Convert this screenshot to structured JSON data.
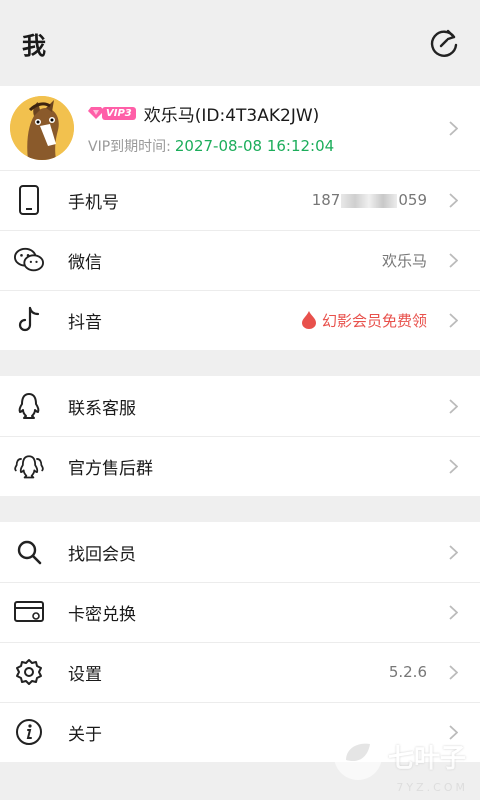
{
  "header": {
    "title": "我"
  },
  "profile": {
    "vip_badge": "VIP3",
    "name": "欢乐马(ID:4T3AK2JW)",
    "expiry_label": "VIP到期时间:",
    "expiry_date": "2027-08-08 16:12:04"
  },
  "account": {
    "phone": {
      "label": "手机号",
      "value_prefix": "187",
      "value_suffix": "059"
    },
    "wechat": {
      "label": "微信",
      "value": "欢乐马"
    },
    "douyin": {
      "label": "抖音",
      "value": "幻影会员免费领"
    }
  },
  "support": {
    "contact": {
      "label": "联系客服"
    },
    "group": {
      "label": "官方售后群"
    }
  },
  "misc": {
    "recover": {
      "label": "找回会员"
    },
    "redeem": {
      "label": "卡密兑换"
    },
    "settings": {
      "label": "设置",
      "value": "5.2.6"
    },
    "about": {
      "label": "关于"
    }
  },
  "watermark": {
    "text": "七叶子",
    "sub": "7YZ.COM"
  },
  "colors": {
    "accent_green": "#1cad5b",
    "vip_pink": "#ff5fa8",
    "red": "#e8514c"
  }
}
